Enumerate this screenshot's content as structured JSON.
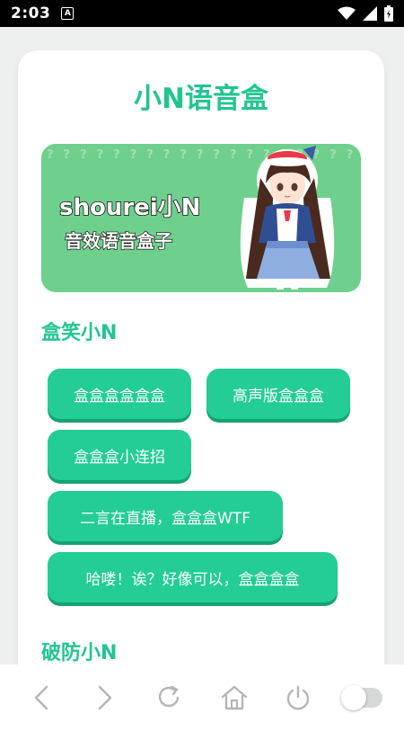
{
  "status_bar": {
    "time": "2:03",
    "notification_icon_label": "A"
  },
  "app": {
    "title": "小N语音盒",
    "accent_color": "#22c591",
    "button_color": "#23cd95"
  },
  "banner": {
    "line1": "shourei小N",
    "line2": "音效语音盒子",
    "pattern_char": "?"
  },
  "sections": [
    {
      "title": "盒笑小N",
      "buttons": [
        "盒盒盒盒盒盒",
        "高声版盒盒盒",
        "盒盒盒小连招",
        "二言在直播，盒盒盒WTF",
        "哈喽！诶？好像可以，盒盒盒盒"
      ]
    },
    {
      "title": "破防小N",
      "buttons": []
    }
  ],
  "browser_bar": {
    "icons": [
      "back-icon",
      "forward-icon",
      "refresh-icon",
      "home-icon",
      "power-icon",
      "toggle-switch"
    ]
  }
}
